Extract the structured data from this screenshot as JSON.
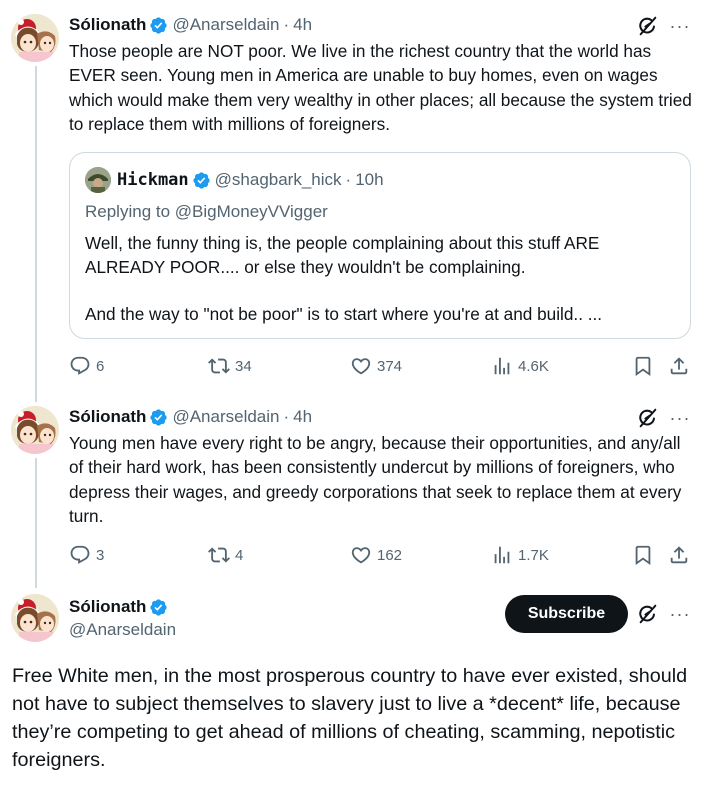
{
  "colors": {
    "verified_blue": "#1d9bf0",
    "text_primary": "#0f1419",
    "text_secondary": "#536471",
    "border": "#cfd9de"
  },
  "reply1": {
    "name": "Sólionath",
    "handle": "@Anarseldain",
    "time": "4h",
    "text": "Those people are NOT poor. We live in the richest country that the world has EVER seen. Young men in America are unable to buy homes, even on wages which would make them very wealthy in other places; all because the system tried to replace them with millions of foreigners.",
    "quote": {
      "name": "Hickman",
      "handle": "@shagbark_hick",
      "time": "10h",
      "replying_prefix": "Replying to",
      "replying_to": "@BigMoneyVVigger",
      "paragraphs": [
        "Well, the funny thing is, the people complaining about this stuff ARE ALREADY POOR.... or else they wouldn't be complaining.",
        "And the way to \"not be poor\" is to start where you're at and build.. ..."
      ]
    },
    "stats": {
      "replies": "6",
      "reposts": "34",
      "likes": "374",
      "views": "4.6K"
    }
  },
  "reply2": {
    "name": "Sólionath",
    "handle": "@Anarseldain",
    "time": "4h",
    "text": "Young men have every right to be angry, because their opportunities, and any/all of their hard work, has been consistently undercut by millions of foreigners, who depress their wages, and greedy corporations that seek to replace them at every turn.",
    "stats": {
      "replies": "3",
      "reposts": "4",
      "likes": "162",
      "views": "1.7K"
    }
  },
  "main": {
    "name": "Sólionath",
    "handle": "@Anarseldain",
    "subscribe_label": "Subscribe",
    "text": "Free White men, in the most prosperous country to have ever existed, should not have to subject themselves to slavery just to live a *decent* life, because they’re competing to get ahead of millions of cheating, scamming, nepotistic foreigners."
  },
  "icons": {
    "verified": "verified-badge-icon",
    "grok": "grok-icon",
    "more": "more-options-icon",
    "reply": "reply-icon",
    "repost": "repost-icon",
    "like": "like-icon",
    "views": "views-icon",
    "bookmark": "bookmark-icon",
    "share": "share-icon"
  },
  "glyphs": {
    "dot": "·",
    "more": "···"
  }
}
